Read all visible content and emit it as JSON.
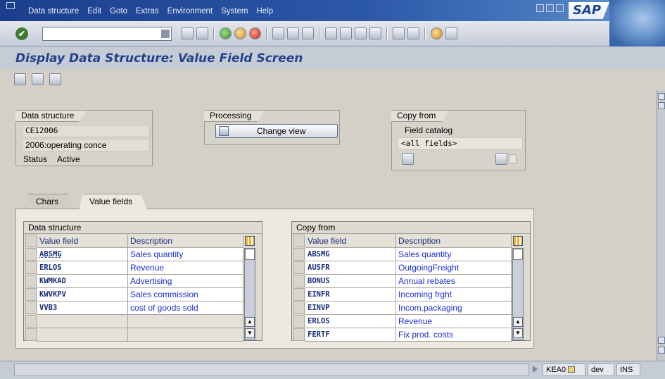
{
  "menu": [
    "Data structure",
    "Edit",
    "Goto",
    "Extras",
    "Environment",
    "System",
    "Help"
  ],
  "logo": "SAP",
  "page_title": "Display Data Structure: Value Field Screen",
  "data_structure_group": {
    "title": "Data structure",
    "name": "CE12006",
    "description": "2006:operating conce",
    "status_label": "Status",
    "status_value": "Active"
  },
  "processing_group": {
    "title": "Processing",
    "change_view_label": "Change view"
  },
  "copy_from_group": {
    "title": "Copy from",
    "field_catalog_label": "Field catalog",
    "field_catalog_value": "<all fields>"
  },
  "tabs": [
    "Chars",
    "Value fields"
  ],
  "left_table": {
    "title": "Data structure",
    "columns": [
      "Value field",
      "Description"
    ],
    "rows": [
      [
        "ABSMG",
        "Sales quantity"
      ],
      [
        "ERLOS",
        "Revenue"
      ],
      [
        "KWMKAD",
        "Advertising"
      ],
      [
        "KWVKPV",
        "Sales commission"
      ],
      [
        "VVB3",
        "cost of goods sold"
      ],
      [
        "",
        ""
      ],
      [
        "",
        ""
      ]
    ]
  },
  "right_table": {
    "title": "Copy from",
    "columns": [
      "Value field",
      "Description"
    ],
    "rows": [
      [
        "ABSMG",
        "Sales quantity"
      ],
      [
        "AUSFR",
        "OutgoingFreight"
      ],
      [
        "BONUS",
        "Annual rebates"
      ],
      [
        "EINFR",
        "Incoming frght"
      ],
      [
        "EINVP",
        "Incom.packaging"
      ],
      [
        "ERLOS",
        "Revenue"
      ],
      [
        "FERTF",
        "Fix prod. costs"
      ]
    ]
  },
  "status_bar": {
    "transaction": "KEA0",
    "client": "dev",
    "mode": "INS"
  }
}
